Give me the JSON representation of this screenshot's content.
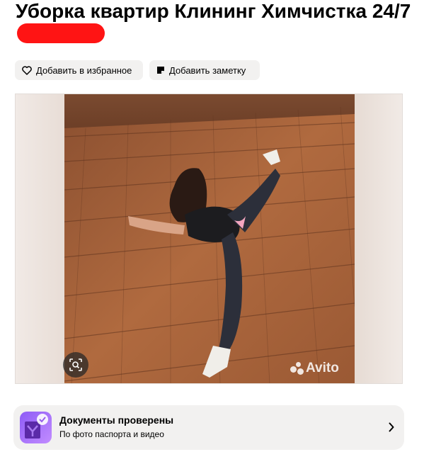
{
  "listing": {
    "title": "Уборка квартир Клининг Химчистка 24/7"
  },
  "actions": {
    "favorite_label": "Добавить в избранное",
    "note_label": "Добавить заметку"
  },
  "gallery": {
    "watermark": "Avito"
  },
  "verification": {
    "title": "Документы проверены",
    "subtitle": "По фото паспорта и видео"
  },
  "colors": {
    "accent": "#965eeb",
    "chip_bg": "#f2f1f0",
    "redaction": "#ff1414"
  },
  "icons": {
    "favorite": "heart-icon",
    "note": "note-icon",
    "lens": "image-search-icon",
    "docs": "document-check-icon",
    "chevron": "chevron-right-icon"
  }
}
